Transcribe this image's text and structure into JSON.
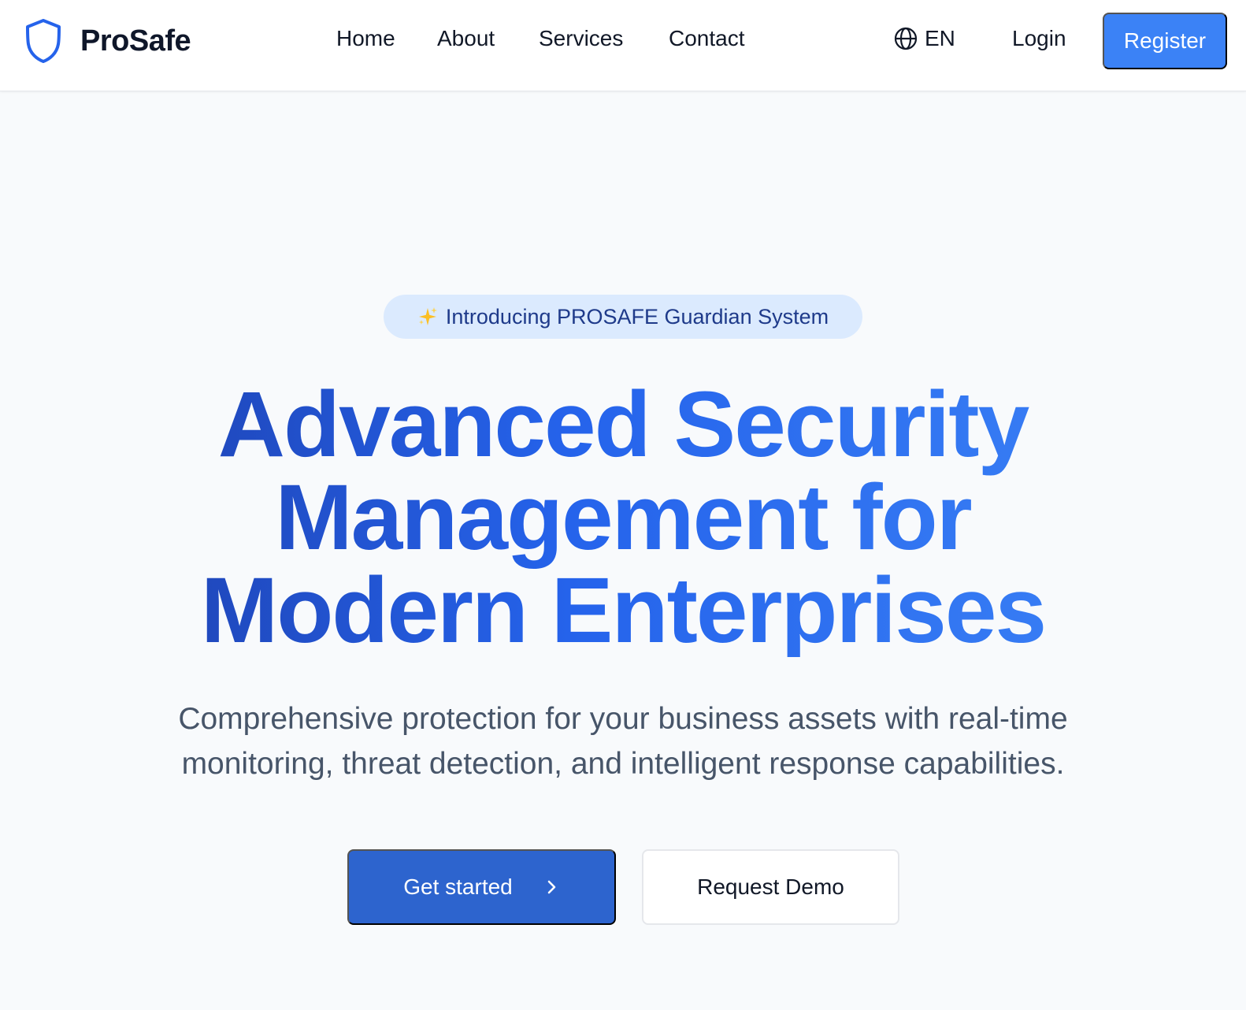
{
  "colors": {
    "brand_blue": "#2563eb",
    "accent_blue": "#3b82f6",
    "cta_blue": "#2d64ce",
    "pill_bg": "#dbeafe",
    "page_bg": "#f8fafc"
  },
  "header": {
    "brand": {
      "name": "ProSafe",
      "icon": "shield-icon"
    },
    "nav": [
      {
        "label": "Home"
      },
      {
        "label": "About"
      },
      {
        "label": "Services"
      },
      {
        "label": "Contact"
      }
    ],
    "language": {
      "icon": "globe-icon",
      "label": "EN"
    },
    "login_label": "Login",
    "register_label": "Register"
  },
  "hero": {
    "badge": {
      "icon": "sparkles-icon",
      "text": "Introducing PROSAFE Guardian System"
    },
    "headline_lines": [
      "Advanced Security",
      "Management for",
      "Modern Enterprises"
    ],
    "subtext_lines": [
      "Comprehensive protection for your business assets with real-time",
      "monitoring, threat detection, and intelligent response capabilities."
    ],
    "primary_cta": {
      "label": "Get started",
      "icon": "chevron-right-icon"
    },
    "secondary_cta": {
      "label": "Request Demo"
    }
  }
}
